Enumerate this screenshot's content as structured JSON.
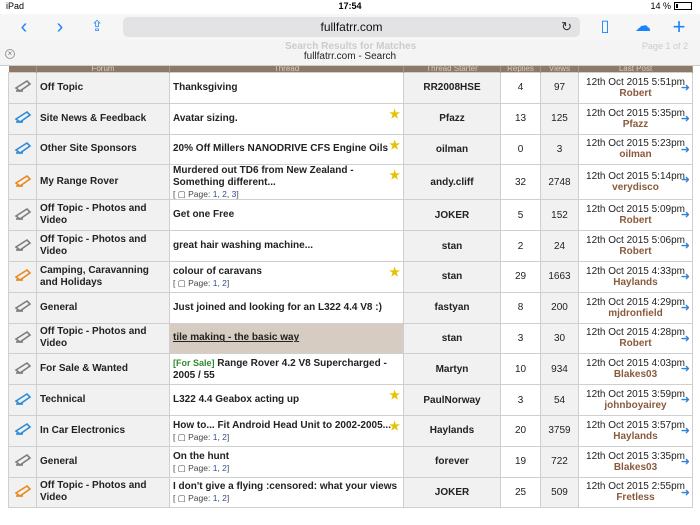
{
  "status_bar": {
    "device": "iPad",
    "time": "17:54",
    "battery": "14 %"
  },
  "browser": {
    "url": "fullfatrr.com",
    "page_title": "fullfatrr.com - Search",
    "ghost_header": "Search Results for Matches",
    "ghost_right": "Page 1 of 2"
  },
  "colors": {
    "accent": "#1a82fb",
    "header_bg": "#8c7a66",
    "starter": "#7a5b44"
  },
  "columns": [
    "",
    "Forum",
    "Thread",
    "Thread Starter",
    "Replies",
    "Views",
    "Last Post"
  ],
  "rows": [
    {
      "icon": "gray",
      "forum": "Off Topic",
      "thread": "Thanksgiving",
      "star": false,
      "starter": "RR2008HSE",
      "replies": "4",
      "views": "97",
      "date": "12th Oct 2015 5:51pm",
      "by": "Robert"
    },
    {
      "icon": "blue",
      "forum": "Site News & Feedback",
      "thread": "Avatar sizing.",
      "star": true,
      "starter": "Pfazz",
      "replies": "13",
      "views": "125",
      "date": "12th Oct 2015 5:35pm",
      "by": "Pfazz"
    },
    {
      "icon": "blue",
      "forum": "Other Site Sponsors",
      "thread": "20% Off Millers NANODRIVE CFS Engine Oils",
      "star": true,
      "starter": "oilman",
      "replies": "0",
      "views": "3",
      "date": "12th Oct 2015 5:23pm",
      "by": "oilman"
    },
    {
      "icon": "orange",
      "forum": "My Range Rover",
      "thread": "Murdered out TD6 from New Zealand - Something different...",
      "star": true,
      "pages": [
        "1",
        "2",
        "3"
      ],
      "starter": "andy.cliff",
      "replies": "32",
      "views": "2748",
      "date": "12th Oct 2015 5:14pm",
      "by": "verydisco"
    },
    {
      "icon": "gray",
      "forum": "Off Topic - Photos and Video",
      "thread": "Get one Free",
      "star": false,
      "starter": "JOKER",
      "replies": "5",
      "views": "152",
      "date": "12th Oct 2015 5:09pm",
      "by": "Robert"
    },
    {
      "icon": "gray",
      "forum": "Off Topic - Photos and Video",
      "thread": "great hair washing machine...",
      "star": false,
      "starter": "stan",
      "replies": "2",
      "views": "24",
      "date": "12th Oct 2015 5:06pm",
      "by": "Robert"
    },
    {
      "icon": "orange",
      "forum": "Camping, Caravanning and Holidays",
      "thread": "colour of caravans",
      "star": true,
      "pages": [
        "1",
        "2"
      ],
      "starter": "stan",
      "replies": "29",
      "views": "1663",
      "date": "12th Oct 2015 4:33pm",
      "by": "Haylands"
    },
    {
      "icon": "gray",
      "forum": "General",
      "thread": "Just joined and looking for an L322 4.4 V8 :)",
      "star": false,
      "starter": "fastyan",
      "replies": "8",
      "views": "200",
      "date": "12th Oct 2015 4:29pm",
      "by": "mjdronfield"
    },
    {
      "icon": "gray",
      "forum": "Off Topic - Photos and Video",
      "thread": "tile making - the basic way",
      "star": false,
      "highlight": true,
      "starter": "stan",
      "replies": "3",
      "views": "30",
      "date": "12th Oct 2015 4:28pm",
      "by": "Robert"
    },
    {
      "icon": "gray",
      "forum": "For Sale & Wanted",
      "prefix": "[For Sale]",
      "thread": "Range Rover 4.2 V8 Supercharged - 2005 / 55",
      "star": false,
      "starter": "Martyn",
      "replies": "10",
      "views": "934",
      "date": "12th Oct 2015 4:03pm",
      "by": "Blakes03"
    },
    {
      "icon": "blue",
      "forum": "Technical",
      "thread": "L322 4.4 Geabox acting up",
      "star": true,
      "starter": "PaulNorway",
      "replies": "3",
      "views": "54",
      "date": "12th Oct 2015 3:59pm",
      "by": "johnboyairey"
    },
    {
      "icon": "blue",
      "forum": "In Car Electronics",
      "thread": "How to... Fit Android Head Unit to 2002-2005...",
      "star": true,
      "pages": [
        "1",
        "2"
      ],
      "starter": "Haylands",
      "replies": "20",
      "views": "3759",
      "date": "12th Oct 2015 3:57pm",
      "by": "Haylands"
    },
    {
      "icon": "gray",
      "forum": "General",
      "thread": "On the hunt",
      "star": false,
      "pages": [
        "1",
        "2"
      ],
      "starter": "forever",
      "replies": "19",
      "views": "722",
      "date": "12th Oct 2015 3:35pm",
      "by": "Blakes03"
    },
    {
      "icon": "orange",
      "forum": "Off Topic - Photos and Video",
      "thread": "I don't give a flying :censored: what your views",
      "star": false,
      "pages": [
        "1",
        "2"
      ],
      "starter": "JOKER",
      "replies": "25",
      "views": "509",
      "date": "12th Oct 2015 2:55pm",
      "by": "Fretless"
    }
  ]
}
